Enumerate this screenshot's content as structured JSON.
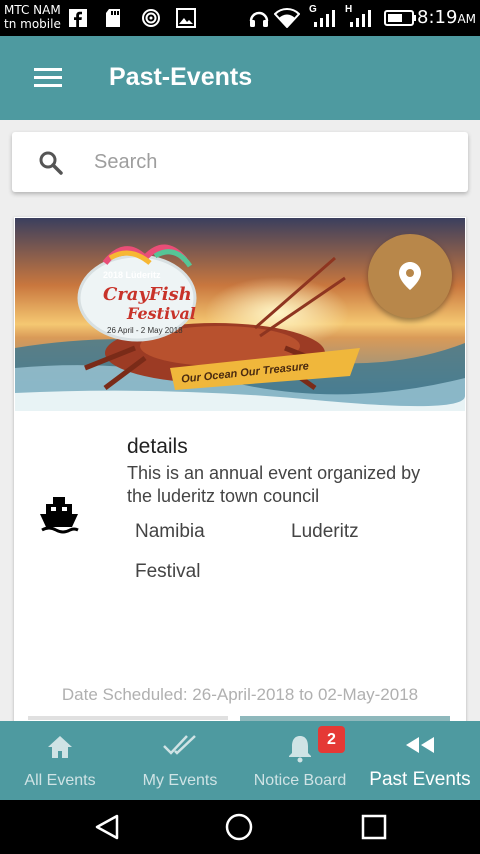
{
  "status_bar": {
    "carrier_line1": "MTC NAM",
    "carrier_line2": "tn mobile",
    "network_g": "G",
    "network_h": "H",
    "time": "8:19",
    "ampm": "AM"
  },
  "app_bar": {
    "title": "Past-Events"
  },
  "search": {
    "placeholder": "Search",
    "value": ""
  },
  "event": {
    "banner": {
      "year_place": "2018 Lüderitz",
      "name_line1": "CrayFish",
      "name_line2": "Festival",
      "dates": "26 April - 2 May 2018",
      "tagline": "Our Ocean Our Treasure"
    },
    "details_title": "details",
    "description": "This is an annual event organized by the luderitz town council",
    "country": "Namibia",
    "town": "Luderitz",
    "category": "Festival",
    "date_scheduled": "Date Scheduled: 26-April-2018 to 02-May-2018"
  },
  "bottom_nav": {
    "items": [
      {
        "label": "All Events",
        "icon": "home-icon"
      },
      {
        "label": "My Events",
        "icon": "double-check-icon"
      },
      {
        "label": "Notice Board",
        "icon": "bell-icon"
      },
      {
        "label": "Past Events",
        "icon": "rewind-icon"
      }
    ],
    "notice_count": "2",
    "active": "Past Events"
  },
  "colors": {
    "primary": "#4e9aa0",
    "fab": "#b8874a",
    "badge": "#e53935"
  }
}
